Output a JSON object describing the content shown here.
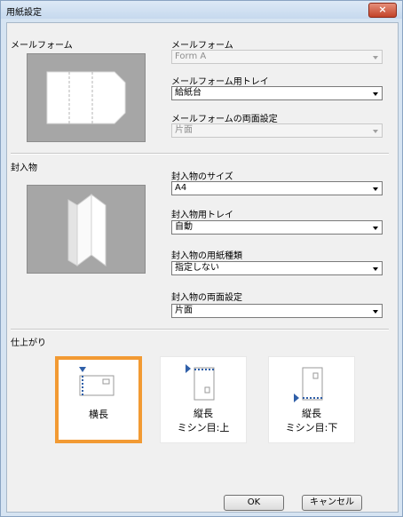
{
  "window": {
    "title": "用紙設定",
    "close_label": "×"
  },
  "mail_form": {
    "section_label": "メールフォーム",
    "form_label": "メールフォーム",
    "form_value": "Form A",
    "tray_label": "メールフォーム用トレイ",
    "tray_value": "給紙台",
    "duplex_label": "メールフォームの両面設定",
    "duplex_value": "片面"
  },
  "insert": {
    "section_label": "封入物",
    "size_label": "封入物のサイズ",
    "size_value": "A4",
    "tray_label": "封入物用トレイ",
    "tray_value": "自動",
    "type_label": "封入物の用紙種類",
    "type_value": "指定しない",
    "duplex_label": "封入物の両面設定",
    "duplex_value": "片面"
  },
  "finish": {
    "section_label": "仕上がり",
    "options": [
      {
        "line1": "横長",
        "line2": "",
        "selected": true
      },
      {
        "line1": "縦長",
        "line2": "ミシン目:上",
        "selected": false
      },
      {
        "line1": "縦長",
        "line2": "ミシン目:下",
        "selected": false
      }
    ]
  },
  "buttons": {
    "ok": "OK",
    "cancel": "キャンセル"
  },
  "colors": {
    "selected_border": "#f29a33",
    "icon_blue": "#2f5fa8",
    "preview_bg": "#a6a6a6"
  }
}
